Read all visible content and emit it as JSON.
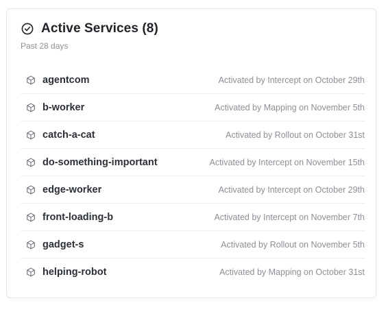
{
  "card": {
    "title": "Active Services (8)",
    "subtitle": "Past 28 days",
    "header_icon": "check-circle-icon",
    "row_icon": "box-icon"
  },
  "services": [
    {
      "name": "agentcom",
      "activation": "Activated by Intercept on October 29th"
    },
    {
      "name": "b-worker",
      "activation": "Activated by Mapping on November 5th"
    },
    {
      "name": "catch-a-cat",
      "activation": "Activated by Rollout on October 31st"
    },
    {
      "name": "do-something-important",
      "activation": "Activated by Intercept on November 15th"
    },
    {
      "name": "edge-worker",
      "activation": "Activated by Intercept on October 29th"
    },
    {
      "name": "front-loading-b",
      "activation": "Activated by Intercept on November 7th"
    },
    {
      "name": "gadget-s",
      "activation": "Activated by Rollout on November 5th"
    },
    {
      "name": "helping-robot",
      "activation": "Activated by Mapping on October 31st"
    }
  ],
  "colors": {
    "title": "#1f2328",
    "muted": "#8b8f96",
    "border": "#e3e4e8"
  }
}
